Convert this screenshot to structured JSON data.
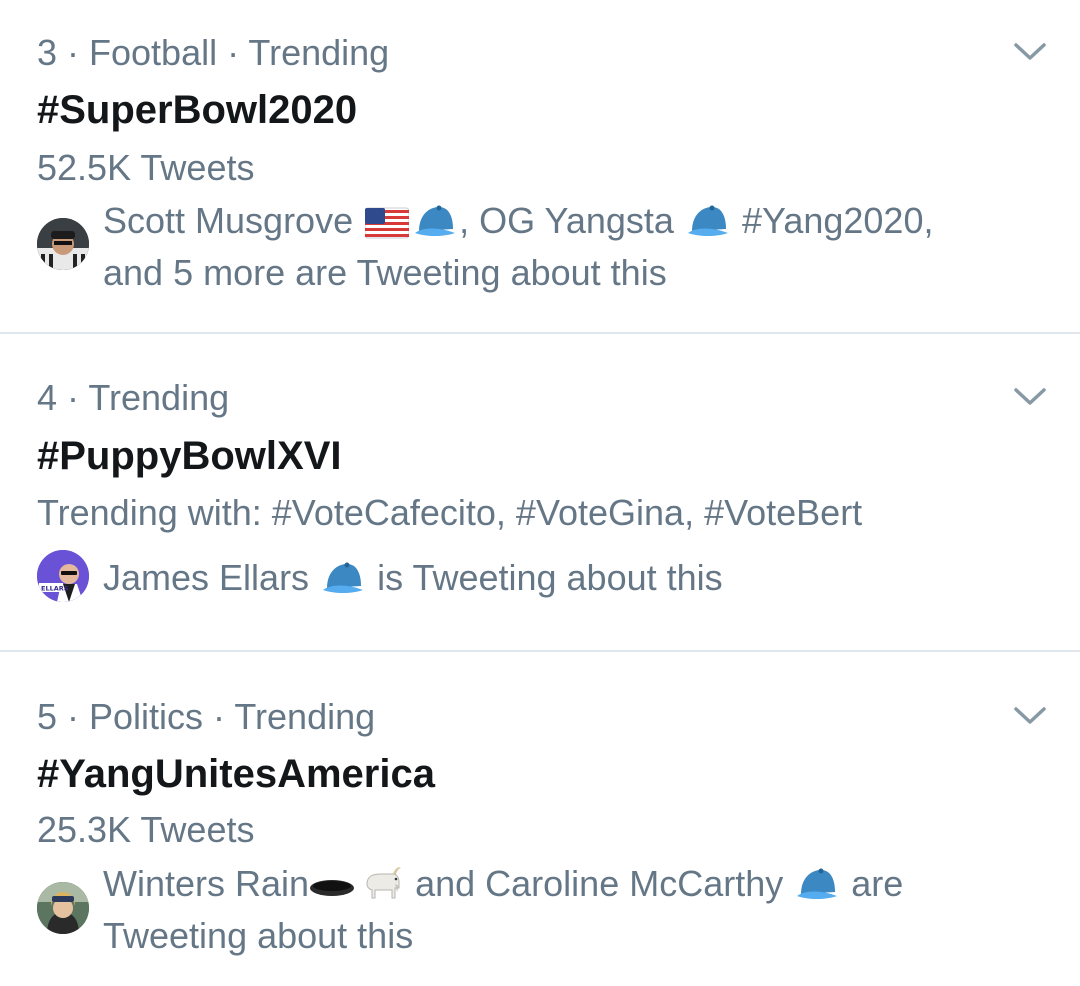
{
  "trends": [
    {
      "meta": "3 · Football · Trending",
      "hashtag": "#SuperBowl2020",
      "sub": "52.5K Tweets",
      "social": {
        "name1": "Scott Musgrove",
        "sep1": ", OG Yangsta",
        "tag": "#Yang2020,",
        "tail": "and 5 more are Tweeting about this"
      }
    },
    {
      "meta": "4 · Trending",
      "hashtag": "#PuppyBowlXVI",
      "sub": "Trending with: #VoteCafecito, #VoteGina, #VoteBert",
      "social": {
        "name1": "James Ellars",
        "tail": "is Tweeting about this",
        "avatar_text": "ELLARS"
      }
    },
    {
      "meta": "5 · Politics · Trending",
      "hashtag": "#YangUnitesAmerica",
      "sub": "25.3K Tweets",
      "social": {
        "name1": "Winters Rain",
        "mid": "and Caroline McCarthy",
        "tail1": "are",
        "tail2": "Tweeting about this"
      }
    }
  ],
  "icons": {
    "chevron": "chevron-down-icon",
    "flag": "us-flag-icon",
    "cap": "blue-cap-icon",
    "hole": "hole-icon",
    "goat": "goat-icon"
  },
  "colors": {
    "secondary_text": "#657786",
    "primary_text": "#14171a",
    "divider": "#e1e8ed",
    "cap_blue": "#3b88c3"
  }
}
